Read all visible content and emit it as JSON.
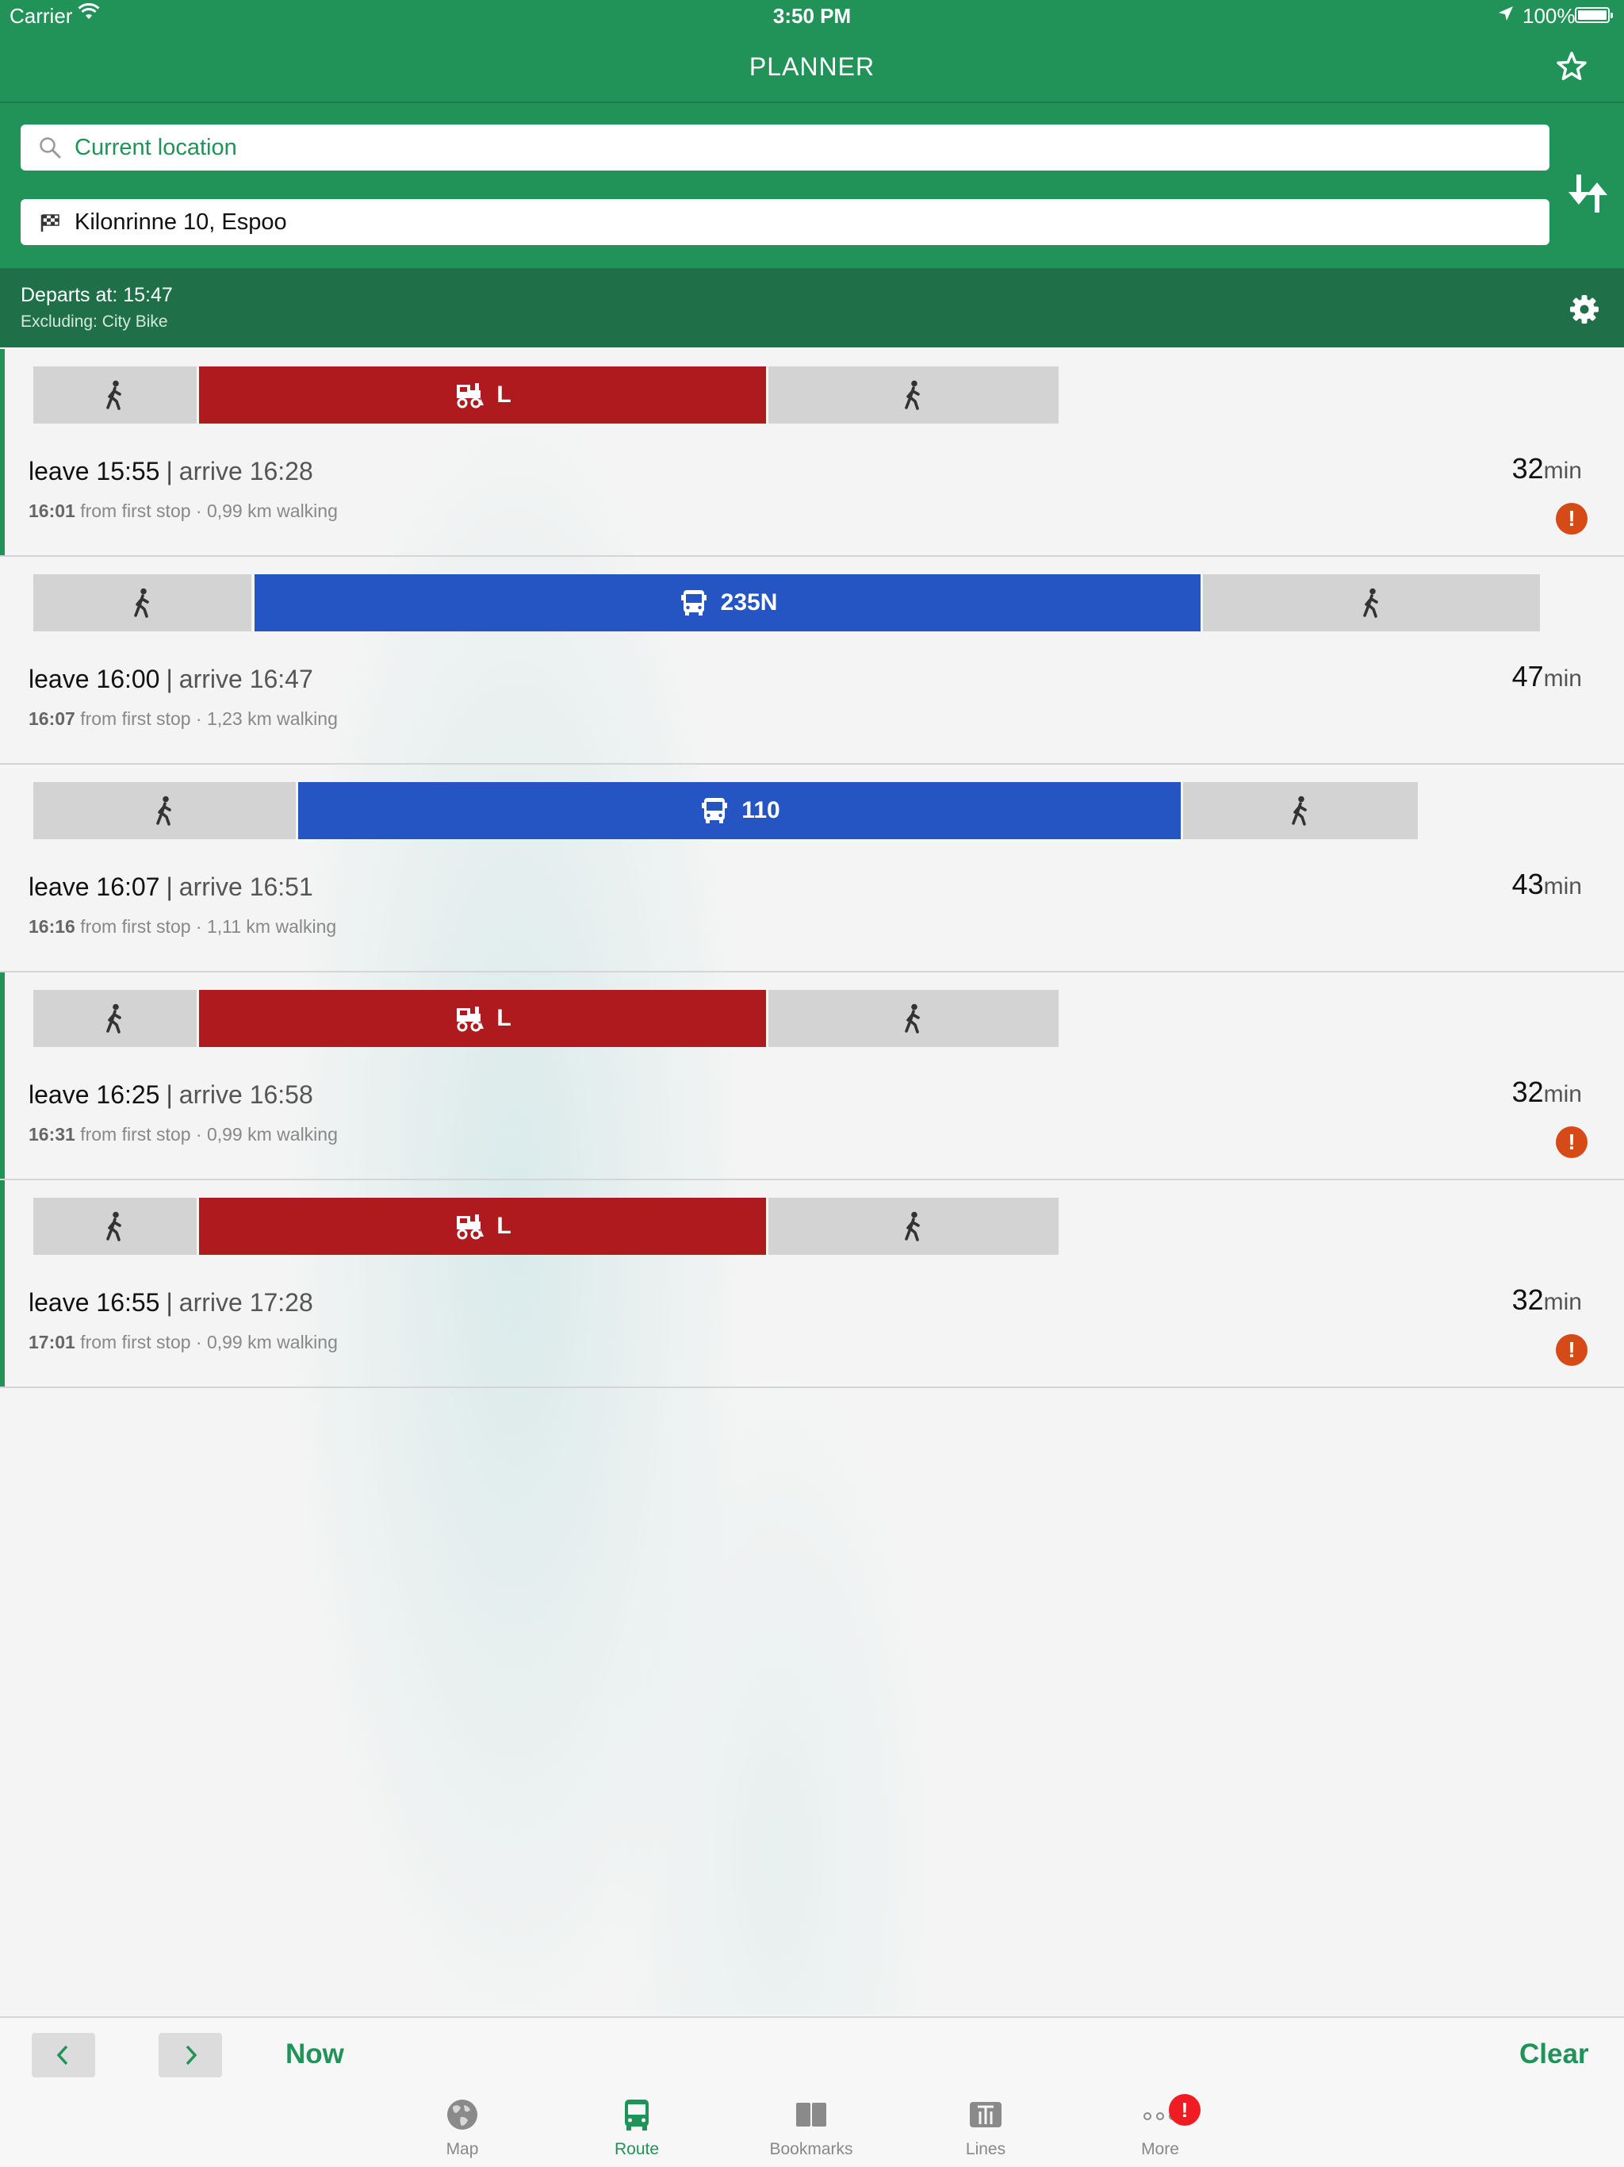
{
  "status_bar": {
    "carrier": "Carrier",
    "time": "3:50 PM",
    "battery": "100%"
  },
  "nav": {
    "title": "PLANNER"
  },
  "search": {
    "from": "Current location",
    "to": "Kilonrinne 10, Espoo"
  },
  "options": {
    "departs": "Departs at: 15:47",
    "excluding": "Excluding: City Bike"
  },
  "colors": {
    "brand": "#219358",
    "train": "#af1a1e",
    "bus": "#2455c3",
    "walk": "#d3d3d3",
    "warning": "#d64a17",
    "badge": "#ef1c24"
  },
  "routes": [
    {
      "leave": "leave 15:55",
      "separator": "|",
      "arrive": "arrive 16:28",
      "first_stop_time": "16:01",
      "details": "from first stop · 0,99 km walking",
      "duration": "32",
      "unit": "min",
      "warning": "!",
      "segments": [
        {
          "mode": "walk",
          "label": ""
        },
        {
          "mode": "train",
          "label": "L"
        },
        {
          "mode": "walk",
          "label": ""
        }
      ]
    },
    {
      "leave": "leave 16:00",
      "separator": "|",
      "arrive": "arrive 16:47",
      "first_stop_time": "16:07",
      "details": "from first stop · 1,23 km walking",
      "duration": "47",
      "unit": "min",
      "warning": "",
      "segments": [
        {
          "mode": "walk",
          "label": ""
        },
        {
          "mode": "bus",
          "label": "235N"
        },
        {
          "mode": "walk",
          "label": ""
        }
      ]
    },
    {
      "leave": "leave 16:07",
      "separator": "|",
      "arrive": "arrive 16:51",
      "first_stop_time": "16:16",
      "details": "from first stop · 1,11 km walking",
      "duration": "43",
      "unit": "min",
      "warning": "",
      "segments": [
        {
          "mode": "walk",
          "label": ""
        },
        {
          "mode": "bus",
          "label": "110"
        },
        {
          "mode": "walk",
          "label": ""
        }
      ]
    },
    {
      "leave": "leave 16:25",
      "separator": "|",
      "arrive": "arrive 16:58",
      "first_stop_time": "16:31",
      "details": "from first stop · 0,99 km walking",
      "duration": "32",
      "unit": "min",
      "warning": "!",
      "segments": [
        {
          "mode": "walk",
          "label": ""
        },
        {
          "mode": "train",
          "label": "L"
        },
        {
          "mode": "walk",
          "label": ""
        }
      ]
    },
    {
      "leave": "leave 16:55",
      "separator": "|",
      "arrive": "arrive 17:28",
      "first_stop_time": "17:01",
      "details": "from first stop · 0,99 km walking",
      "duration": "32",
      "unit": "min",
      "warning": "!",
      "segments": [
        {
          "mode": "walk",
          "label": ""
        },
        {
          "mode": "train",
          "label": "L"
        },
        {
          "mode": "walk",
          "label": ""
        }
      ]
    }
  ],
  "actions": {
    "now": "Now",
    "clear": "Clear"
  },
  "tabs": [
    {
      "label": "Map",
      "icon": "globe-icon"
    },
    {
      "label": "Route",
      "icon": "bus-icon",
      "active": true
    },
    {
      "label": "Bookmarks",
      "icon": "book-icon"
    },
    {
      "label": "Lines",
      "icon": "lines-icon"
    },
    {
      "label": "More",
      "icon": "more-icon",
      "badge": "!"
    }
  ]
}
